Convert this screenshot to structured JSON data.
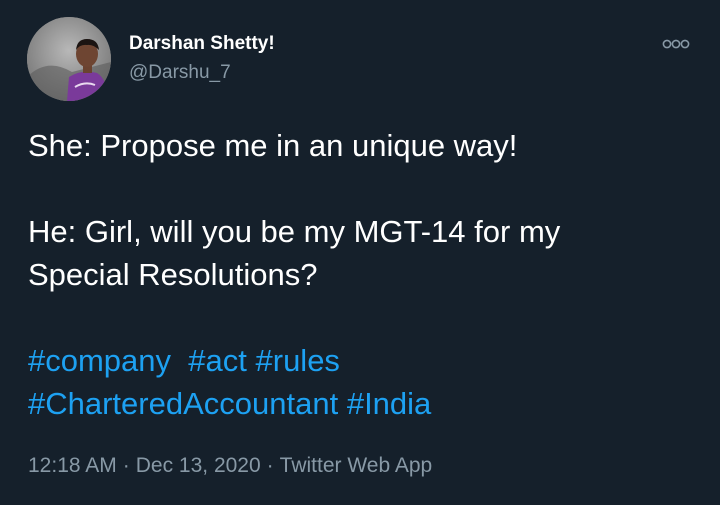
{
  "tweet": {
    "author": {
      "display_name": "Darshan Shetty!",
      "handle": "@Darshu_7",
      "avatar_icon": "profile-photo"
    },
    "more_icon": "more-options-icon",
    "text": {
      "line1": "She: Propose me in an unique way!",
      "line2": "He: Girl, will you be my MGT-14 for my",
      "line3": "Special Resolutions?"
    },
    "hashtags": {
      "company": "#company",
      "act": "#act",
      "rules": "#rules",
      "chartered": "#CharteredAccountant",
      "india": "#India"
    },
    "meta": {
      "time": "12:18 AM",
      "date": "Dec 13, 2020",
      "source": "Twitter Web App",
      "separator": "·"
    }
  },
  "colors": {
    "background": "#15202b",
    "text": "#ffffff",
    "secondary": "#8899a6",
    "link": "#1da1f2"
  }
}
